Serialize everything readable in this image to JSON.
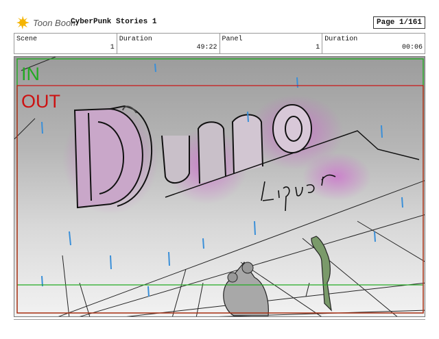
{
  "header": {
    "brand": "Toon Boom",
    "project_title": "CyberPunk Stories 1",
    "page_label": "Page",
    "page_value": "1/161"
  },
  "info": {
    "scene_label": "Scene",
    "scene_value": "1",
    "scene_duration_label": "Duration",
    "scene_duration_value": "49:22",
    "panel_label": "Panel",
    "panel_value": "1",
    "panel_duration_label": "Duration",
    "panel_duration_value": "00:06"
  },
  "panel": {
    "in_label": "IN",
    "out_label": "OUT",
    "sign_text": "Dunno",
    "sign_subtext": "Liquor",
    "colors": {
      "in": "#22aa22",
      "out": "#cc1111",
      "glow": "#d24fd2",
      "rain": "#3a8fd8",
      "figure": "#7a9a6a"
    }
  }
}
